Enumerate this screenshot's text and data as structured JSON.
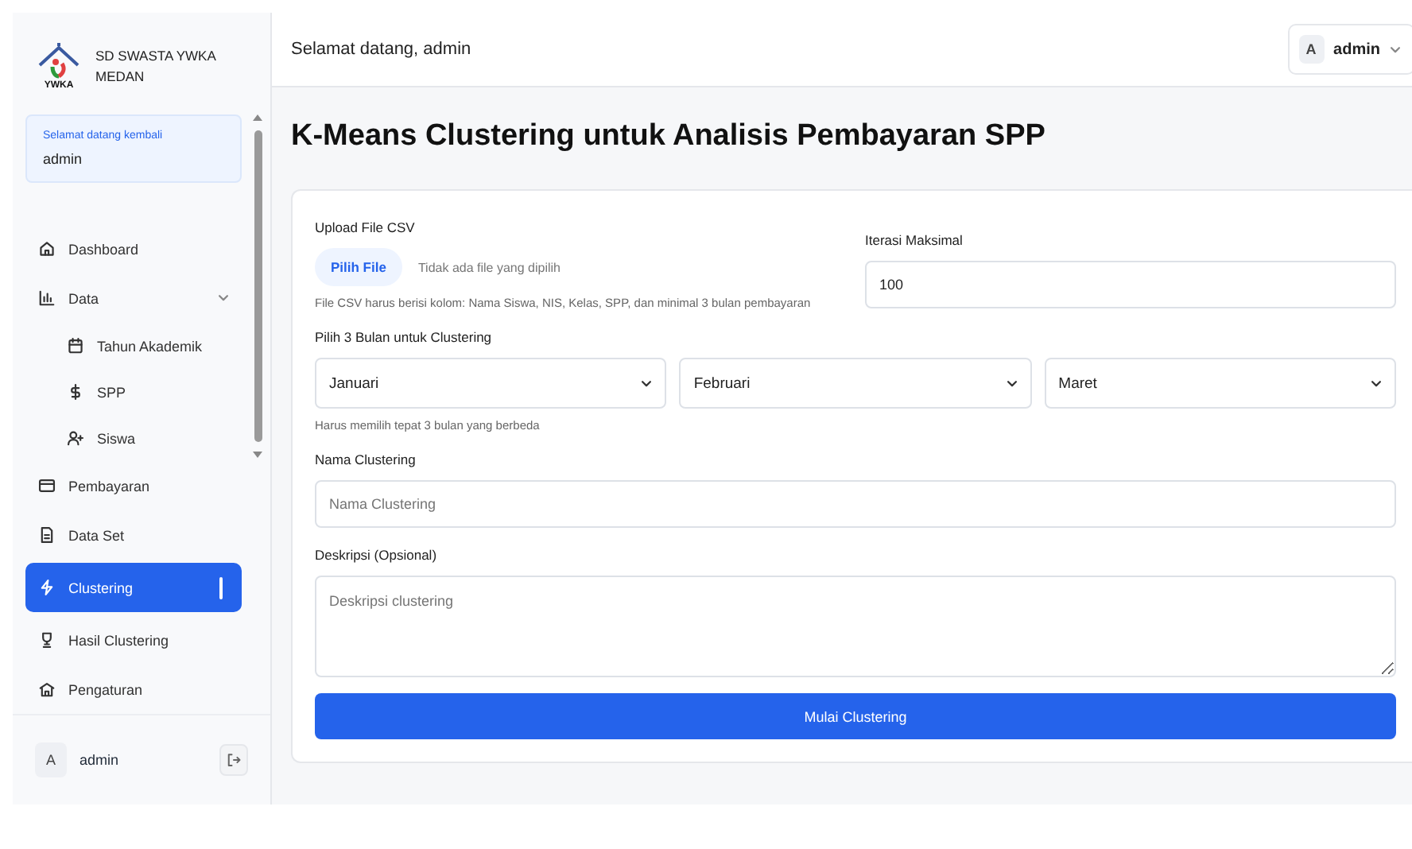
{
  "sidebar": {
    "logo_text": "YWKA",
    "school_name": "SD SWASTA YWKA MEDAN",
    "welcome": {
      "label": "Selamat datang kembali",
      "user": "admin"
    },
    "nav": [
      {
        "label": "Dashboard",
        "selected": false
      },
      {
        "label": "Data",
        "selected": false,
        "expanded": true,
        "children": [
          {
            "label": "Tahun Akademik",
            "selected": false
          },
          {
            "label": "SPP",
            "selected": false
          },
          {
            "label": "Siswa",
            "selected": false
          }
        ]
      },
      {
        "label": "Pembayaran",
        "selected": false
      },
      {
        "label": "Data Set",
        "selected": false
      },
      {
        "label": "Clustering",
        "selected": true
      },
      {
        "label": "Hasil Clustering",
        "selected": false
      },
      {
        "label": "Pengaturan",
        "selected": false
      }
    ],
    "user": {
      "avatar": "A",
      "name": "admin"
    }
  },
  "header": {
    "greeting": "Selamat datang, admin",
    "user": {
      "avatar": "A",
      "name": "admin"
    }
  },
  "title": "K-Means Clustering untuk Analisis Pembayaran SPP",
  "form": {
    "file": {
      "label": "Upload File CSV",
      "button": "Pilih File",
      "status": "Tidak ada file yang dipilih",
      "help": "File CSV harus berisi kolom: Nama Siswa, NIS, Kelas, SPP, dan minimal 3 bulan pembayaran"
    },
    "iterations": {
      "label": "Iterasi Maksimal",
      "value": "100"
    },
    "months": {
      "label": "Pilih 3 Bulan untuk Clustering",
      "selects": [
        {
          "value": "Januari"
        },
        {
          "value": "Februari"
        },
        {
          "value": "Maret"
        }
      ],
      "help": "Harus memilih tepat 3 bulan yang berbeda"
    },
    "name": {
      "label": "Nama Clustering",
      "placeholder": "Nama Clustering"
    },
    "description": {
      "label": "Deskripsi (Opsional)",
      "placeholder": "Deskripsi clustering"
    },
    "submit": "Mulai Clustering"
  }
}
